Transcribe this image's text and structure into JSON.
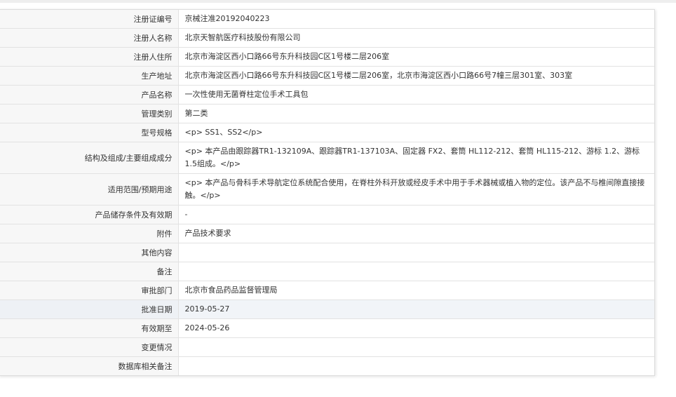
{
  "rows": [
    {
      "label": "注册证编号",
      "value": "京械注准20192040223",
      "lines": 1
    },
    {
      "label": "注册人名称",
      "value": "北京天智航医疗科技股份有限公司",
      "lines": 1
    },
    {
      "label": "注册人住所",
      "value": "北京市海淀区西小口路66号东升科技园C区1号楼二层206室",
      "lines": 1
    },
    {
      "label": "生产地址",
      "value": "北京市海淀区西小口路66号东升科技园C区1号楼二层206室，北京市海淀区西小口路66号7幢三层301室、303室",
      "lines": 1
    },
    {
      "label": "产品名称",
      "value": "一次性使用无菌脊柱定位手术工具包",
      "lines": 1
    },
    {
      "label": "管理类别",
      "value": "第二类",
      "lines": 1
    },
    {
      "label": "型号规格",
      "value": "<p> SS1、SS2</p>",
      "lines": 1
    },
    {
      "label": "结构及组成/主要组成成分",
      "value": "<p> 本产品由跟踪器TR1-132109A、跟踪器TR1-137103A、固定器 FX2、套筒 HL112-212、套筒 HL115-212、游标 1.2、游标 1.5组成。</p>",
      "lines": 2
    },
    {
      "label": "适用范围/预期用途",
      "value": "<p> 本产品与骨科手术导航定位系统配合使用，在脊柱外科开放或经皮手术中用于手术器械或植入物的定位。该产品不与椎间隙直接接触。</p>",
      "lines": 2
    },
    {
      "label": "产品储存条件及有效期",
      "value": "-",
      "lines": 1
    },
    {
      "label": "附件",
      "value": "产品技术要求",
      "lines": 1
    },
    {
      "label": "其他内容",
      "value": "",
      "lines": 1
    },
    {
      "label": "备注",
      "value": "",
      "lines": 1
    },
    {
      "label": "审批部门",
      "value": "北京市食品药品监督管理局",
      "lines": 1
    },
    {
      "label": "批准日期",
      "value": "2019-05-27",
      "lines": 1,
      "highlight": true
    },
    {
      "label": "有效期至",
      "value": "2024-05-26",
      "lines": 1
    },
    {
      "label": "变更情况",
      "value": "",
      "lines": 1
    },
    {
      "label": "数据库相关备注",
      "value": "",
      "lines": 1
    }
  ]
}
